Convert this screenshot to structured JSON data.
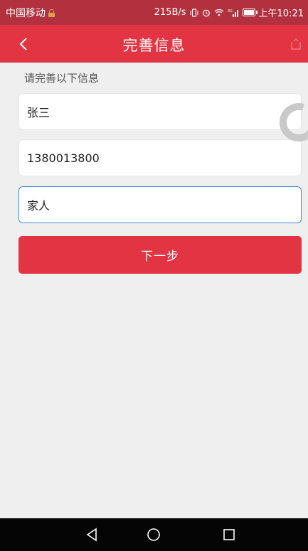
{
  "status_bar": {
    "carrier": "中国移动",
    "net_speed": "215B/s",
    "signal_tag": "3G",
    "time": "上午10:21"
  },
  "nav": {
    "title": "完善信息"
  },
  "form": {
    "section_label": "请完善以下信息",
    "name_value": "张三",
    "phone_value": "1380013800",
    "relation_value": "家人",
    "next_label": "下一步"
  },
  "colors": {
    "accent": "#e23443",
    "status_bar": "#b3313e",
    "focus_border": "#3f8ad6",
    "background": "#efefef"
  },
  "icons": {
    "back": "chevron-left-icon",
    "share": "share-icon",
    "spinner": "loading-spinner-icon",
    "sys_back": "triangle-back-icon",
    "sys_home": "circle-home-icon",
    "sys_recent": "square-recent-icon"
  }
}
